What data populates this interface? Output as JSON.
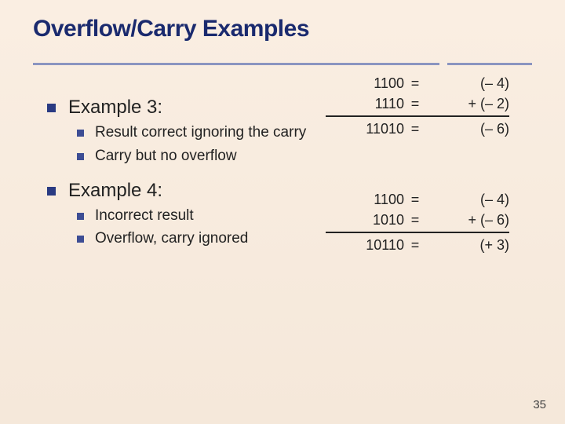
{
  "title": "Overflow/Carry Examples",
  "examples": [
    {
      "heading": "Example 3:",
      "points": [
        "Result correct ignoring the carry",
        "Carry but no overflow"
      ],
      "calc": {
        "rows": [
          {
            "bin": "1100",
            "eq": "=",
            "dec": "(– 4)"
          },
          {
            "bin": "1110",
            "eq": "=",
            "dec": "+ (– 2)"
          }
        ],
        "result": {
          "bin": "11010",
          "eq": "=",
          "dec": "(– 6)"
        }
      }
    },
    {
      "heading": "Example 4:",
      "points": [
        "Incorrect result",
        "Overflow, carry ignored"
      ],
      "calc": {
        "rows": [
          {
            "bin": "1100",
            "eq": "=",
            "dec": "(– 4)"
          },
          {
            "bin": "1010",
            "eq": "=",
            "dec": "+ (– 6)"
          }
        ],
        "result": {
          "bin": "10110",
          "eq": "=",
          "dec": "(+ 3)"
        }
      }
    }
  ],
  "pagenum": "35"
}
